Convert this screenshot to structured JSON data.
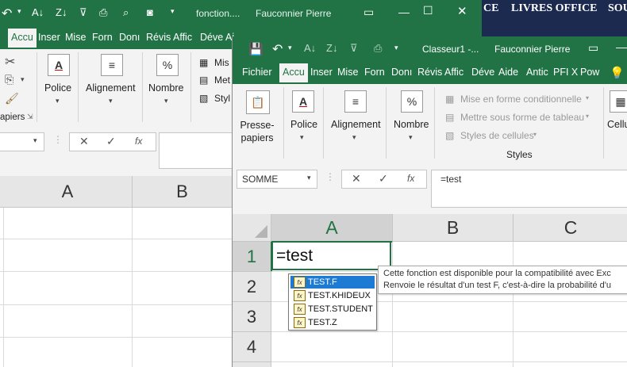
{
  "back_window": {
    "title": "fonction....",
    "user": "Fauconnier Pierre",
    "tabs": [
      "Accu",
      "Inser",
      "Mise",
      "Forn",
      "Donı",
      "Révis",
      "Affic",
      "Déve",
      "Ai"
    ],
    "ribbon": {
      "police": "Police",
      "alignment": "Alignement",
      "number": "Nombre",
      "styles": [
        "Mis",
        "Met",
        "Styl"
      ],
      "clipboard_group": "apiers"
    },
    "columns": [
      "A",
      "B"
    ]
  },
  "web_banner": {
    "items": [
      "CE",
      "LIVRES OFFICE",
      "SOU"
    ]
  },
  "front_window": {
    "title": "Classeur1 -...",
    "user": "Fauconnier Pierre",
    "tabs": [
      "Fichier",
      "Accu",
      "Inser",
      "Mise",
      "Forn",
      "Donı",
      "Révis",
      "Affic",
      "Déve",
      "Aide",
      "Antic",
      "PFI X",
      "Pow"
    ],
    "ribbon": {
      "paste_label": "Presse-papiers",
      "police": "Police",
      "alignment": "Alignement",
      "number": "Nombre",
      "cond_format": "Mise en forme conditionnelle",
      "table_format": "Mettre sous forme de tableau",
      "cell_styles": "Styles de cellules",
      "styles_group": "Styles",
      "cells": "Cellu"
    },
    "name_box": "SOMME",
    "formula": "=test",
    "columns": [
      "A",
      "B",
      "C"
    ],
    "rows": [
      "1",
      "2",
      "3",
      "4"
    ],
    "cell_A1": "=test",
    "autocomplete": [
      "TEST.F",
      "TEST.KHIDEUX",
      "TEST.STUDENT",
      "TEST.Z"
    ],
    "tooltip_line1": "Cette fonction est disponible pour la compatibilité avec Exc",
    "tooltip_line2": "Renvoie le résultat d'un test F, c'est-à-dire la probabilité d'u"
  },
  "colors": {
    "excel_green": "#217346",
    "ribbon_bg": "#f3f3f3",
    "selection_blue": "#1e7bd4",
    "banner_navy": "#1c2a4f"
  }
}
